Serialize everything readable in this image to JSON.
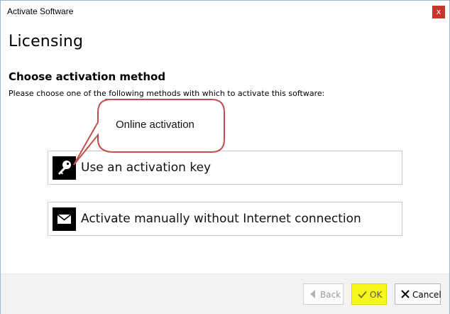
{
  "window": {
    "title": "Activate Software",
    "close_label": "x"
  },
  "page": {
    "heading": "Licensing",
    "subheading": "Choose activation method",
    "instruction": "Please choose one of the following methods with which to activate this software:"
  },
  "options": [
    {
      "label": "Use an activation key",
      "icon": "key-icon"
    },
    {
      "label": "Activate manually without Internet connection",
      "icon": "envelope-icon"
    }
  ],
  "callout": {
    "text": "Online activation",
    "color": "#c0504d"
  },
  "footer": {
    "back_label": "Back",
    "ok_label": "OK",
    "cancel_label": "Cancel",
    "ok_highlight": "#f6f61c"
  }
}
